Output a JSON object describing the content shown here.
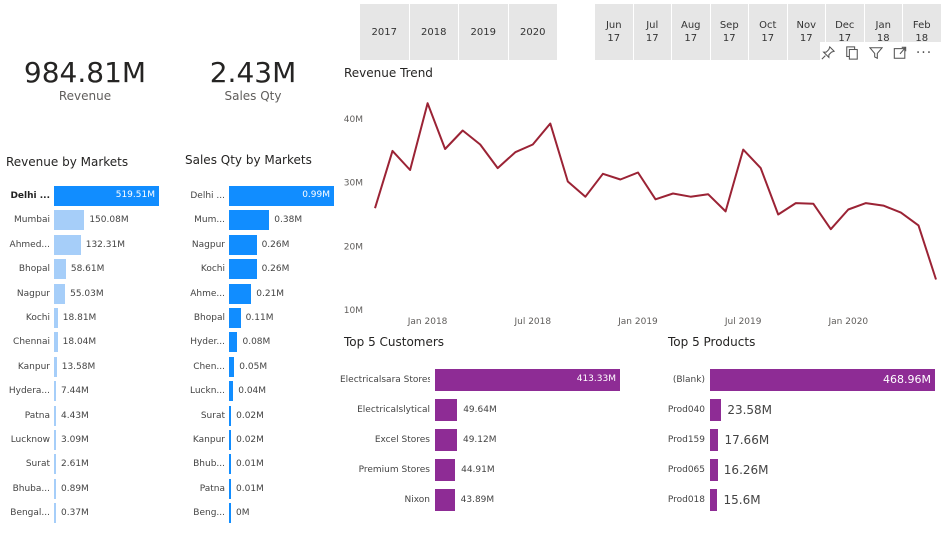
{
  "slicers": {
    "years": [
      "2017",
      "2018",
      "2019",
      "2020"
    ],
    "months": [
      {
        "m": "Jun",
        "y": "17"
      },
      {
        "m": "Jul",
        "y": "17"
      },
      {
        "m": "Aug",
        "y": "17"
      },
      {
        "m": "Sep",
        "y": "17"
      },
      {
        "m": "Oct",
        "y": "17"
      },
      {
        "m": "Nov",
        "y": "17"
      },
      {
        "m": "Dec",
        "y": "17"
      },
      {
        "m": "Jan",
        "y": "18"
      },
      {
        "m": "Feb",
        "y": "18"
      }
    ]
  },
  "kpis": {
    "revenue": {
      "value": "984.81M",
      "label": "Revenue"
    },
    "sales_qty": {
      "value": "2.43M",
      "label": "Sales Qty"
    }
  },
  "visual_header": {
    "icons": [
      "pin-icon",
      "copy-icon",
      "filter-icon",
      "focus-mode-icon",
      "more-options-icon"
    ],
    "more_label": "···"
  },
  "colors": {
    "bar_selected": "#118DFF",
    "bar_unselected": "#A6CEF9",
    "line": "#9B2335",
    "purple": "#8E2C95"
  },
  "revenue_by_markets": {
    "title": "Revenue by Markets",
    "rows": [
      {
        "cat": "Delhi ...",
        "value": 519.51,
        "label": "519.51M",
        "selected": true
      },
      {
        "cat": "Mumbai",
        "value": 150.08,
        "label": "150.08M",
        "selected": false
      },
      {
        "cat": "Ahmed...",
        "value": 132.31,
        "label": "132.31M",
        "selected": false
      },
      {
        "cat": "Bhopal",
        "value": 58.61,
        "label": "58.61M",
        "selected": false
      },
      {
        "cat": "Nagpur",
        "value": 55.03,
        "label": "55.03M",
        "selected": false
      },
      {
        "cat": "Kochi",
        "value": 18.81,
        "label": "18.81M",
        "selected": false
      },
      {
        "cat": "Chennai",
        "value": 18.04,
        "label": "18.04M",
        "selected": false
      },
      {
        "cat": "Kanpur",
        "value": 13.58,
        "label": "13.58M",
        "selected": false
      },
      {
        "cat": "Hydera...",
        "value": 7.44,
        "label": "7.44M",
        "selected": false
      },
      {
        "cat": "Patna",
        "value": 4.43,
        "label": "4.43M",
        "selected": false
      },
      {
        "cat": "Lucknow",
        "value": 3.09,
        "label": "3.09M",
        "selected": false
      },
      {
        "cat": "Surat",
        "value": 2.61,
        "label": "2.61M",
        "selected": false
      },
      {
        "cat": "Bhuba...",
        "value": 0.89,
        "label": "0.89M",
        "selected": false
      },
      {
        "cat": "Bengal...",
        "value": 0.37,
        "label": "0.37M",
        "selected": false
      }
    ]
  },
  "sales_qty_by_markets": {
    "title": "Sales Qty by Markets",
    "rows": [
      {
        "cat": "Delhi ...",
        "value": 0.99,
        "label": "0.99M"
      },
      {
        "cat": "Mum...",
        "value": 0.38,
        "label": "0.38M"
      },
      {
        "cat": "Nagpur",
        "value": 0.26,
        "label": "0.26M"
      },
      {
        "cat": "Kochi",
        "value": 0.26,
        "label": "0.26M"
      },
      {
        "cat": "Ahme...",
        "value": 0.21,
        "label": "0.21M"
      },
      {
        "cat": "Bhopal",
        "value": 0.11,
        "label": "0.11M"
      },
      {
        "cat": "Hyder...",
        "value": 0.08,
        "label": "0.08M"
      },
      {
        "cat": "Chen...",
        "value": 0.05,
        "label": "0.05M"
      },
      {
        "cat": "Luckn...",
        "value": 0.04,
        "label": "0.04M"
      },
      {
        "cat": "Surat",
        "value": 0.02,
        "label": "0.02M"
      },
      {
        "cat": "Kanpur",
        "value": 0.02,
        "label": "0.02M"
      },
      {
        "cat": "Bhub...",
        "value": 0.01,
        "label": "0.01M"
      },
      {
        "cat": "Patna",
        "value": 0.01,
        "label": "0.01M"
      },
      {
        "cat": "Beng...",
        "value": 0.0,
        "label": "0M"
      }
    ]
  },
  "chart_data": [
    {
      "type": "line",
      "title": "Revenue Trend",
      "y_ticks": [
        "10M",
        "20M",
        "30M",
        "40M"
      ],
      "x_ticks": [
        "Jan 2018",
        "Jul 2018",
        "Jan 2019",
        "Jul 2019",
        "Jan 2020"
      ],
      "ylim": [
        10,
        43
      ],
      "x": [
        "2017-10",
        "2017-11",
        "2017-12",
        "2018-01",
        "2018-02",
        "2018-03",
        "2018-04",
        "2018-05",
        "2018-06",
        "2018-07",
        "2018-08",
        "2018-09",
        "2018-10",
        "2018-11",
        "2018-12",
        "2019-01",
        "2019-02",
        "2019-03",
        "2019-04",
        "2019-05",
        "2019-06",
        "2019-07",
        "2019-08",
        "2019-09",
        "2019-10",
        "2019-11",
        "2019-12",
        "2020-01",
        "2020-02",
        "2020-03",
        "2020-04",
        "2020-05",
        "2020-06"
      ],
      "series": [
        {
          "values": [
            26,
            35,
            32,
            42.5,
            35.3,
            38.2,
            36,
            32.3,
            34.8,
            36,
            39.3,
            30.2,
            27.8,
            31.4,
            30.5,
            31.6,
            27.4,
            28.3,
            27.8,
            28.2,
            25.5,
            35.2,
            32.3,
            25,
            26.8,
            26.7,
            22.7,
            25.8,
            26.8,
            26.4,
            25.3,
            23.3,
            14.8
          ]
        }
      ]
    },
    {
      "type": "bar",
      "title": "Top 5 Customers",
      "categories": [
        "Electricalsara Stores",
        "Electricalslytical",
        "Excel Stores",
        "Premium Stores",
        "Nixon"
      ],
      "values": [
        413.33,
        49.64,
        49.12,
        44.91,
        43.89
      ],
      "labels": [
        "413.33M",
        "49.64M",
        "49.12M",
        "44.91M",
        "43.89M"
      ]
    },
    {
      "type": "bar",
      "title": "Top 5 Products",
      "categories": [
        "(Blank)",
        "Prod040",
        "Prod159",
        "Prod065",
        "Prod018"
      ],
      "values": [
        468.96,
        23.58,
        17.66,
        16.26,
        15.6
      ],
      "labels": [
        "468.96M",
        "23.58M",
        "17.66M",
        "16.26M",
        "15.6M"
      ]
    }
  ]
}
